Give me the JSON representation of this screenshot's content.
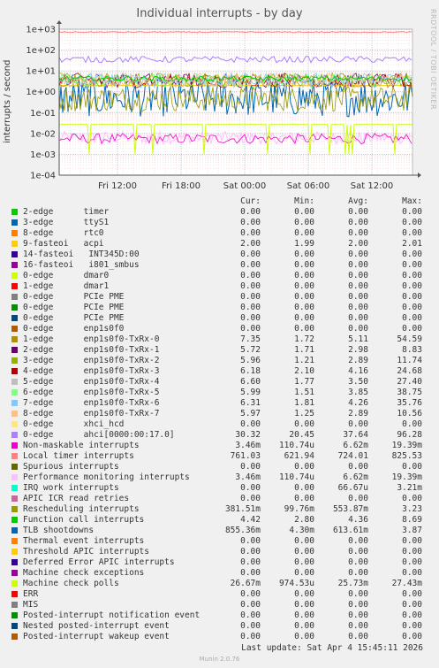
{
  "side_label": "RRDTOOL / TOBI OETIKER",
  "chart_data": {
    "type": "line",
    "title": "Individual interrupts - by day",
    "ylabel": "interrupts / second",
    "yscale": "log",
    "ylim": [
      0.0001,
      1000
    ],
    "y_ticks": [
      "1e+03",
      "1e+02",
      "1e+01",
      "1e+00",
      "1e-01",
      "1e-02",
      "1e-03",
      "1e-04"
    ],
    "x_ticks": [
      "Fri 12:00",
      "Fri 18:00",
      "Sat 00:00",
      "Sat 06:00",
      "Sat 12:00"
    ],
    "grid": true
  },
  "legend_header": {
    "cur": "Cur:",
    "min": "Min:",
    "avg": "Avg:",
    "max": "Max:"
  },
  "legend": [
    {
      "color": "#00cc00",
      "name": "2-edge      timer",
      "cur": "0.00",
      "min": "0.00",
      "avg": "0.00",
      "max": "0.00"
    },
    {
      "color": "#0066b3",
      "name": "3-edge      ttyS1",
      "cur": "0.00",
      "min": "0.00",
      "avg": "0.00",
      "max": "0.00"
    },
    {
      "color": "#ff8000",
      "name": "8-edge      rtc0",
      "cur": "0.00",
      "min": "0.00",
      "avg": "0.00",
      "max": "0.00"
    },
    {
      "color": "#ffcc00",
      "name": "9-fasteoi   acpi",
      "cur": "2.00",
      "min": "1.99",
      "avg": "2.00",
      "max": "2.01"
    },
    {
      "color": "#330099",
      "name": "14-fasteoi   INT345D:00",
      "cur": "0.00",
      "min": "0.00",
      "avg": "0.00",
      "max": "0.00"
    },
    {
      "color": "#990099",
      "name": "16-fasteoi   i801_smbus",
      "cur": "0.00",
      "min": "0.00",
      "avg": "0.00",
      "max": "0.00"
    },
    {
      "color": "#ccff00",
      "name": "0-edge      dmar0",
      "cur": "0.00",
      "min": "0.00",
      "avg": "0.00",
      "max": "0.00"
    },
    {
      "color": "#ff0000",
      "name": "1-edge      dmar1",
      "cur": "0.00",
      "min": "0.00",
      "avg": "0.00",
      "max": "0.00"
    },
    {
      "color": "#808080",
      "name": "0-edge      PCIe PME",
      "cur": "0.00",
      "min": "0.00",
      "avg": "0.00",
      "max": "0.00"
    },
    {
      "color": "#008f00",
      "name": "0-edge      PCIe PME",
      "cur": "0.00",
      "min": "0.00",
      "avg": "0.00",
      "max": "0.00"
    },
    {
      "color": "#00487d",
      "name": "0-edge      PCIe PME",
      "cur": "0.00",
      "min": "0.00",
      "avg": "0.00",
      "max": "0.00"
    },
    {
      "color": "#b35a00",
      "name": "0-edge      enp1s0f0",
      "cur": "0.00",
      "min": "0.00",
      "avg": "0.00",
      "max": "0.00"
    },
    {
      "color": "#b38f00",
      "name": "1-edge      enp1s0f0-TxRx-0",
      "cur": "7.35",
      "min": "1.72",
      "avg": "5.11",
      "max": "54.59"
    },
    {
      "color": "#6b006b",
      "name": "2-edge      enp1s0f0-TxRx-1",
      "cur": "5.72",
      "min": "1.71",
      "avg": "2.98",
      "max": "8.83"
    },
    {
      "color": "#8fb300",
      "name": "3-edge      enp1s0f0-TxRx-2",
      "cur": "5.96",
      "min": "1.21",
      "avg": "2.89",
      "max": "11.74"
    },
    {
      "color": "#b30000",
      "name": "4-edge      enp1s0f0-TxRx-3",
      "cur": "6.18",
      "min": "2.10",
      "avg": "4.16",
      "max": "24.68"
    },
    {
      "color": "#bebebe",
      "name": "5-edge      enp1s0f0-TxRx-4",
      "cur": "6.60",
      "min": "1.77",
      "avg": "3.50",
      "max": "27.40"
    },
    {
      "color": "#80ff80",
      "name": "6-edge      enp1s0f0-TxRx-5",
      "cur": "5.99",
      "min": "1.51",
      "avg": "3.85",
      "max": "38.75"
    },
    {
      "color": "#80c9ff",
      "name": "7-edge      enp1s0f0-TxRx-6",
      "cur": "6.31",
      "min": "1.81",
      "avg": "4.26",
      "max": "35.76"
    },
    {
      "color": "#ffc080",
      "name": "8-edge      enp1s0f0-TxRx-7",
      "cur": "5.97",
      "min": "1.25",
      "avg": "2.89",
      "max": "10.56"
    },
    {
      "color": "#ffe680",
      "name": "0-edge      xhci_hcd",
      "cur": "0.00",
      "min": "0.00",
      "avg": "0.00",
      "max": "0.00"
    },
    {
      "color": "#aa80ff",
      "name": "0-edge      ahci[0000:00:17.0]",
      "cur": "30.32",
      "min": "20.45",
      "avg": "37.64",
      "max": "96.28"
    },
    {
      "color": "#ee00cc",
      "name": "Non-maskable interrupts",
      "cur": "3.46m",
      "min": "110.74u",
      "avg": "6.62m",
      "max": "19.39m"
    },
    {
      "color": "#ff8080",
      "name": "Local timer interrupts",
      "cur": "761.03",
      "min": "621.94",
      "avg": "724.01",
      "max": "825.53"
    },
    {
      "color": "#666600",
      "name": "Spurious interrupts",
      "cur": "0.00",
      "min": "0.00",
      "avg": "0.00",
      "max": "0.00"
    },
    {
      "color": "#ffbfff",
      "name": "Performance monitoring interrupts",
      "cur": "3.46m",
      "min": "110.74u",
      "avg": "6.62m",
      "max": "19.39m"
    },
    {
      "color": "#00ffcc",
      "name": "IRQ work interrupts",
      "cur": "0.00",
      "min": "0.00",
      "avg": "66.67u",
      "max": "3.21m"
    },
    {
      "color": "#cc6699",
      "name": "APIC ICR read retries",
      "cur": "0.00",
      "min": "0.00",
      "avg": "0.00",
      "max": "0.00"
    },
    {
      "color": "#999900",
      "name": "Rescheduling interrupts",
      "cur": "381.51m",
      "min": "99.76m",
      "avg": "553.87m",
      "max": "3.23"
    },
    {
      "color": "#00cc00",
      "name": "Function call interrupts",
      "cur": "4.42",
      "min": "2.80",
      "avg": "4.36",
      "max": "8.69"
    },
    {
      "color": "#0066b3",
      "name": "TLB shootdowns",
      "cur": "855.36m",
      "min": "4.30m",
      "avg": "613.61m",
      "max": "3.87"
    },
    {
      "color": "#ff8000",
      "name": "Thermal event interrupts",
      "cur": "0.00",
      "min": "0.00",
      "avg": "0.00",
      "max": "0.00"
    },
    {
      "color": "#ffcc00",
      "name": "Threshold APIC interrupts",
      "cur": "0.00",
      "min": "0.00",
      "avg": "0.00",
      "max": "0.00"
    },
    {
      "color": "#330099",
      "name": "Deferred Error APIC interrupts",
      "cur": "0.00",
      "min": "0.00",
      "avg": "0.00",
      "max": "0.00"
    },
    {
      "color": "#990099",
      "name": "Machine check exceptions",
      "cur": "0.00",
      "min": "0.00",
      "avg": "0.00",
      "max": "0.00"
    },
    {
      "color": "#ccff00",
      "name": "Machine check polls",
      "cur": "26.67m",
      "min": "974.53u",
      "avg": "25.73m",
      "max": "27.43m"
    },
    {
      "color": "#ff0000",
      "name": "ERR",
      "cur": "0.00",
      "min": "0.00",
      "avg": "0.00",
      "max": "0.00"
    },
    {
      "color": "#808080",
      "name": "MIS",
      "cur": "0.00",
      "min": "0.00",
      "avg": "0.00",
      "max": "0.00"
    },
    {
      "color": "#008f00",
      "name": "Posted-interrupt notification event",
      "cur": "0.00",
      "min": "0.00",
      "avg": "0.00",
      "max": "0.00"
    },
    {
      "color": "#00487d",
      "name": "Nested posted-interrupt event",
      "cur": "0.00",
      "min": "0.00",
      "avg": "0.00",
      "max": "0.00"
    },
    {
      "color": "#b35a00",
      "name": "Posted-interrupt wakeup event",
      "cur": "0.00",
      "min": "0.00",
      "avg": "0.00",
      "max": "0.00"
    }
  ],
  "last_update": "Last update: Sat Apr  4 15:45:11 2026",
  "munin_version": "Munin 2.0.76"
}
